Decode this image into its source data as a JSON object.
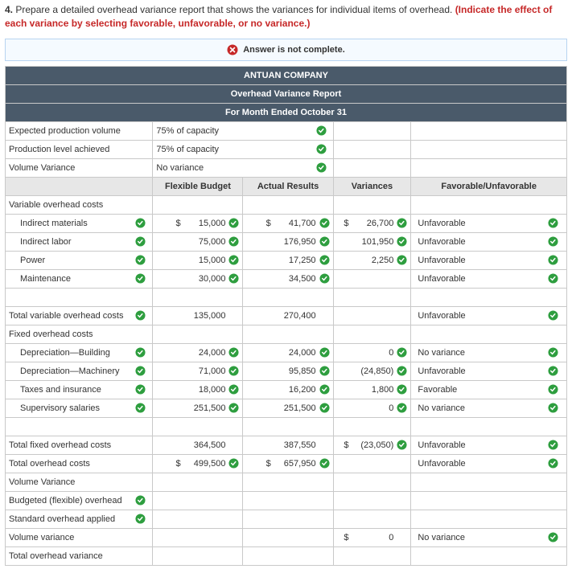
{
  "prompt": {
    "num": "4.",
    "text": "Prepare a detailed overhead variance report that shows the variances for individual items of overhead.",
    "red": "(Indicate the effect of each variance by selecting favorable, unfavorable, or no variance.)"
  },
  "status": "Answer is not complete.",
  "header": {
    "company": "ANTUAN COMPANY",
    "title": "Overhead Variance Report",
    "period": "For Month Ended October 31"
  },
  "top_rows": [
    {
      "label": "Expected production volume",
      "value": "75% of capacity",
      "check": true
    },
    {
      "label": "Production level achieved",
      "value": "75% of capacity",
      "check": true
    },
    {
      "label": "Volume Variance",
      "value": "No variance",
      "check": true
    }
  ],
  "col_headers": {
    "fb": "Flexible Budget",
    "ar": "Actual Results",
    "var": "Variances",
    "fu": "Favorable/Unfavorable"
  },
  "sections": {
    "variable_header": "Variable overhead costs",
    "fixed_header": "Fixed overhead costs"
  },
  "rows": {
    "ind_mat": {
      "label": "Indirect materials",
      "lblcheck": true,
      "fb_cur": "$",
      "fb": "15,000",
      "fbc": true,
      "ar_cur": "$",
      "ar": "41,700",
      "arc": true,
      "var_cur": "$",
      "var": "26,700",
      "varc": true,
      "fu": "Unfavorable",
      "fuc": true
    },
    "ind_lab": {
      "label": "Indirect labor",
      "lblcheck": true,
      "fb": "75,000",
      "fbc": true,
      "ar": "176,950",
      "arc": true,
      "var": "101,950",
      "varc": true,
      "fu": "Unfavorable",
      "fuc": true
    },
    "power": {
      "label": "Power",
      "lblcheck": true,
      "fb": "15,000",
      "fbc": true,
      "ar": "17,250",
      "arc": true,
      "var": "2,250",
      "varc": true,
      "fu": "Unfavorable",
      "fuc": true
    },
    "maint": {
      "label": "Maintenance",
      "lblcheck": true,
      "fb": "30,000",
      "fbc": true,
      "ar": "34,500",
      "arc": true,
      "fu": "Unfavorable",
      "fuc": true
    },
    "tot_var": {
      "label": "Total variable overhead costs",
      "lblcheck": true,
      "fb": "135,000",
      "ar": "270,400",
      "fu": "Unfavorable",
      "fuc": true
    },
    "dep_bld": {
      "label": "Depreciation—Building",
      "lblcheck": true,
      "fb": "24,000",
      "fbc": true,
      "ar": "24,000",
      "arc": true,
      "var": "0",
      "varc": true,
      "fu": "No variance",
      "fuc": true
    },
    "dep_mach": {
      "label": "Depreciation—Machinery",
      "lblcheck": true,
      "fb": "71,000",
      "fbc": true,
      "ar": "95,850",
      "arc": true,
      "var": "(24,850)",
      "varc": true,
      "fu": "Unfavorable",
      "fuc": true
    },
    "tax_ins": {
      "label": "Taxes and insurance",
      "lblcheck": true,
      "fb": "18,000",
      "fbc": true,
      "ar": "16,200",
      "arc": true,
      "var": "1,800",
      "varc": true,
      "fu": "Favorable",
      "fuc": true
    },
    "sup_sal": {
      "label": "Supervisory salaries",
      "lblcheck": true,
      "fb": "251,500",
      "fbc": true,
      "ar": "251,500",
      "arc": true,
      "var": "0",
      "varc": true,
      "fu": "No variance",
      "fuc": true
    },
    "tot_fix": {
      "label": "Total fixed overhead costs",
      "fb": "364,500",
      "ar": "387,550",
      "var_cur": "$",
      "var": "(23,050)",
      "varc": true,
      "fu": "Unfavorable",
      "fuc": true
    },
    "tot_oh": {
      "label": "Total overhead costs",
      "fb_cur": "$",
      "fb": "499,500",
      "fbc": true,
      "ar_cur": "$",
      "ar": "657,950",
      "arc": true,
      "fu": "Unfavorable",
      "fuc": true
    },
    "vol_var_h": {
      "label": "Volume Variance"
    },
    "bud_flex": {
      "label": "Budgeted (flexible) overhead",
      "lblcheck": true
    },
    "std_app": {
      "label": "Standard overhead applied",
      "lblcheck": true
    },
    "vol_var": {
      "label": "Volume variance",
      "var_cur": "$",
      "var": "0",
      "fu": "No variance",
      "fuc": true
    },
    "tot_oh_var": {
      "label": "Total overhead variance"
    }
  }
}
